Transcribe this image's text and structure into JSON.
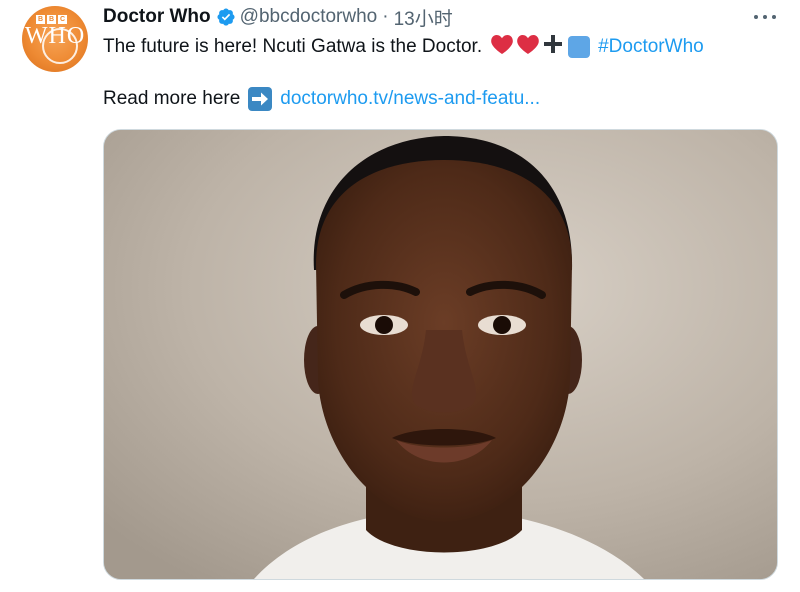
{
  "tweet": {
    "display_name": "Doctor Who",
    "handle": "@bbcdoctorwho",
    "separator": "·",
    "timestamp": "13小时",
    "text": "The future is here! Ncuti Gatwa is the Doctor.",
    "hashtag": "#DoctorWho",
    "read_more_text": "Read more here",
    "link_text": "doctorwho.tv/news-and-featu..."
  },
  "avatar": {
    "logo_letters": [
      "B",
      "B",
      "C"
    ],
    "logo_text": "WHO"
  },
  "colors": {
    "accent": "#1d9bf0",
    "avatar_orange": "#ee8a33",
    "secondary_text": "#536471"
  },
  "icons": {
    "verified": "verified-badge-icon",
    "more": "more-options-icon",
    "emoji_sequence": [
      "red-heart-emoji",
      "red-heart-emoji",
      "heavy-plus-emoji",
      "blue-square-emoji"
    ],
    "arrow": "right-arrow-emoji"
  }
}
